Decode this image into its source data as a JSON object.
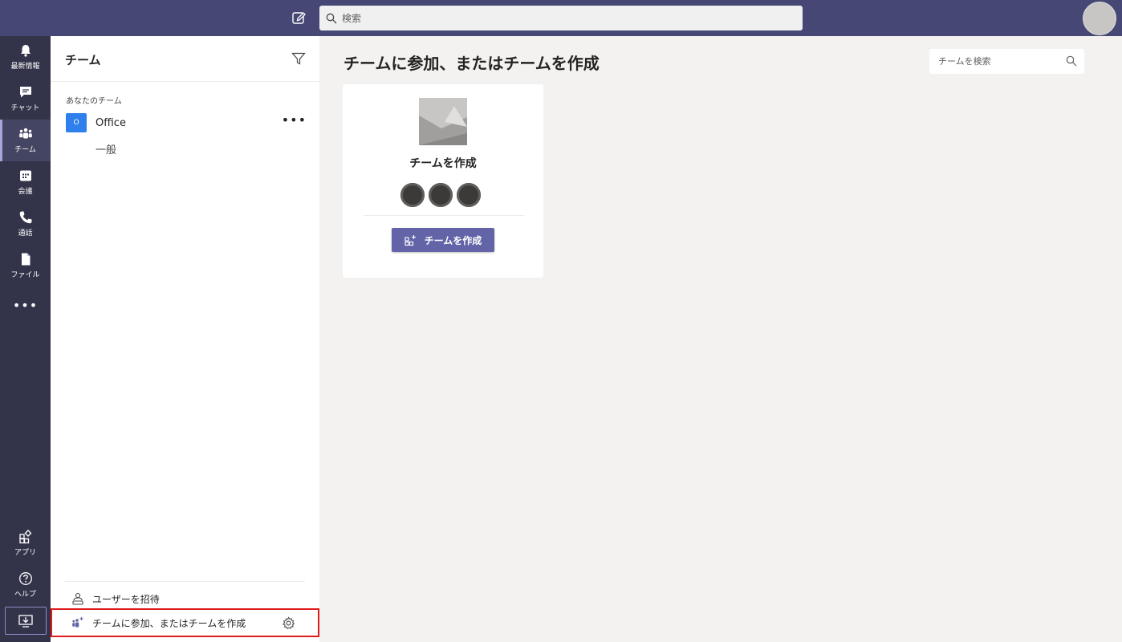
{
  "topbar": {
    "search_placeholder": "検索",
    "icons": {
      "compose": "compose-icon",
      "search": "search-icon",
      "avatar": "avatar"
    }
  },
  "rail": {
    "items": [
      {
        "label": "最新情報",
        "icon": "bell-icon"
      },
      {
        "label": "チャット",
        "icon": "chat-icon"
      },
      {
        "label": "チーム",
        "icon": "teams-icon",
        "active": true
      },
      {
        "label": "会議",
        "icon": "calendar-icon"
      },
      {
        "label": "通話",
        "icon": "phone-icon"
      },
      {
        "label": "ファイル",
        "icon": "file-icon"
      },
      {
        "label": "アプリ",
        "icon": "apps-icon"
      },
      {
        "label": "ヘルプ",
        "icon": "help-icon"
      }
    ],
    "more": "•••",
    "download_icon": "download-icon"
  },
  "panel": {
    "title": "チーム",
    "section_label": "あなたのチーム",
    "team": {
      "initial": "O",
      "name": "Office",
      "more": "•••"
    },
    "channel": "一般",
    "invite_label": "ユーザーを招待",
    "join_label": "チームに参加、またはチームを作成"
  },
  "main": {
    "title": "チームに参加、またはチームを作成",
    "team_search_placeholder": "チームを検索",
    "card": {
      "title": "チームを作成",
      "button_label": "チームを作成"
    }
  },
  "colors": {
    "topbar": "#464775",
    "rail": "#33344a",
    "accent": "#6264a7",
    "team_tile": "#2f80ed",
    "highlight_border": "#e01b1b"
  }
}
